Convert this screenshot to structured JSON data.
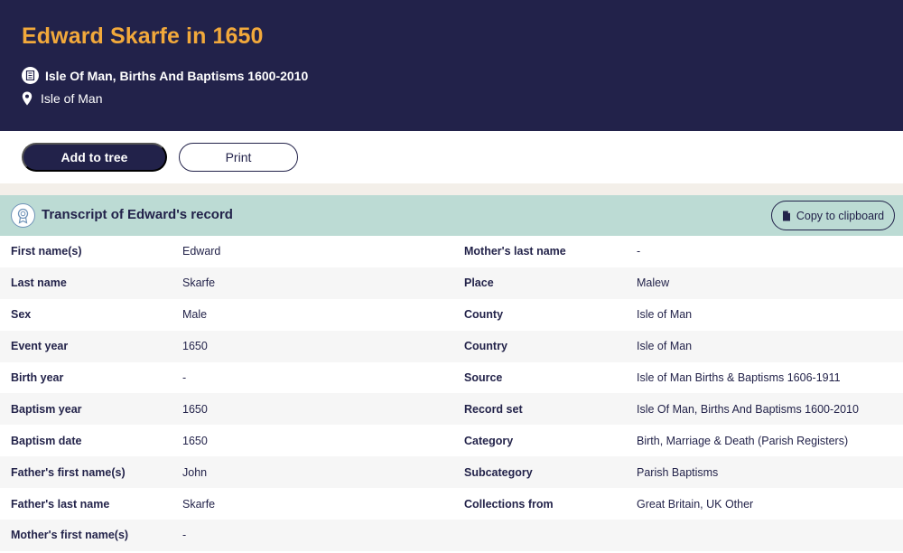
{
  "header": {
    "title": "Edward Skarfe in 1650",
    "record_set": "Isle Of Man, Births And Baptisms 1600-2010",
    "location": "Isle of Man"
  },
  "actions": {
    "add_to_tree": "Add to tree",
    "print": "Print"
  },
  "transcript": {
    "title": "Transcript of Edward's record",
    "copy_label": "Copy to clipboard",
    "rows": [
      {
        "k1": "First name(s)",
        "v1": "Edward",
        "k2": "Mother's last name",
        "v2": "-"
      },
      {
        "k1": "Last name",
        "v1": "Skarfe",
        "k2": "Place",
        "v2": "Malew"
      },
      {
        "k1": "Sex",
        "v1": "Male",
        "k2": "County",
        "v2": "Isle of Man"
      },
      {
        "k1": "Event year",
        "v1": "1650",
        "k2": "Country",
        "v2": "Isle of Man"
      },
      {
        "k1": "Birth year",
        "v1": "-",
        "k2": "Source",
        "v2": "Isle of Man Births & Baptisms 1606-1911"
      },
      {
        "k1": "Baptism year",
        "v1": "1650",
        "k2": "Record set",
        "v2": "Isle Of Man, Births And Baptisms 1600-2010"
      },
      {
        "k1": "Baptism date",
        "v1": "1650",
        "k2": "Category",
        "v2": "Birth, Marriage & Death (Parish Registers)"
      },
      {
        "k1": "Father's first name(s)",
        "v1": "John",
        "k2": "Subcategory",
        "v2": "Parish Baptisms"
      },
      {
        "k1": "Father's last name",
        "v1": "Skarfe",
        "k2": "Collections from",
        "v2": "Great Britain, UK Other"
      },
      {
        "k1": "Mother's first name(s)",
        "v1": "-",
        "k2": "",
        "v2": ""
      }
    ]
  },
  "colors": {
    "header_bg": "#22224a",
    "title": "#f2a93b",
    "section_bg": "#bcdbd4",
    "strip": "#f3efe9"
  },
  "icons": {
    "record_set": "book-icon",
    "location": "map-pin-icon",
    "section": "certificate-badge-icon",
    "copy": "document-icon"
  }
}
